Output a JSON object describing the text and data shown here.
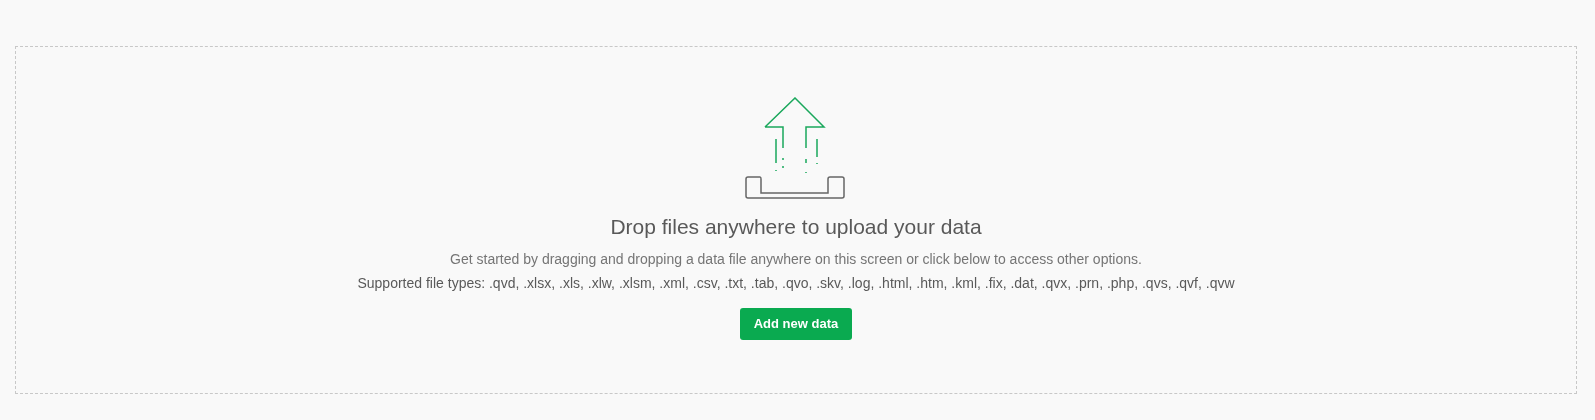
{
  "dropzone": {
    "title": "Drop files anywhere to upload your data",
    "description": "Get started by dragging and dropping a data file anywhere on this screen or click below to access other options.",
    "file_types": "Supported file types: .qvd, .xlsx, .xls, .xlw, .xlsm, .xml, .csv, .txt, .tab, .qvo, .skv, .log, .html, .htm, .kml, .fix, .dat, .qvx, .prn, .php, .qvs, .qvf, .qvw",
    "button": "Add new data"
  }
}
